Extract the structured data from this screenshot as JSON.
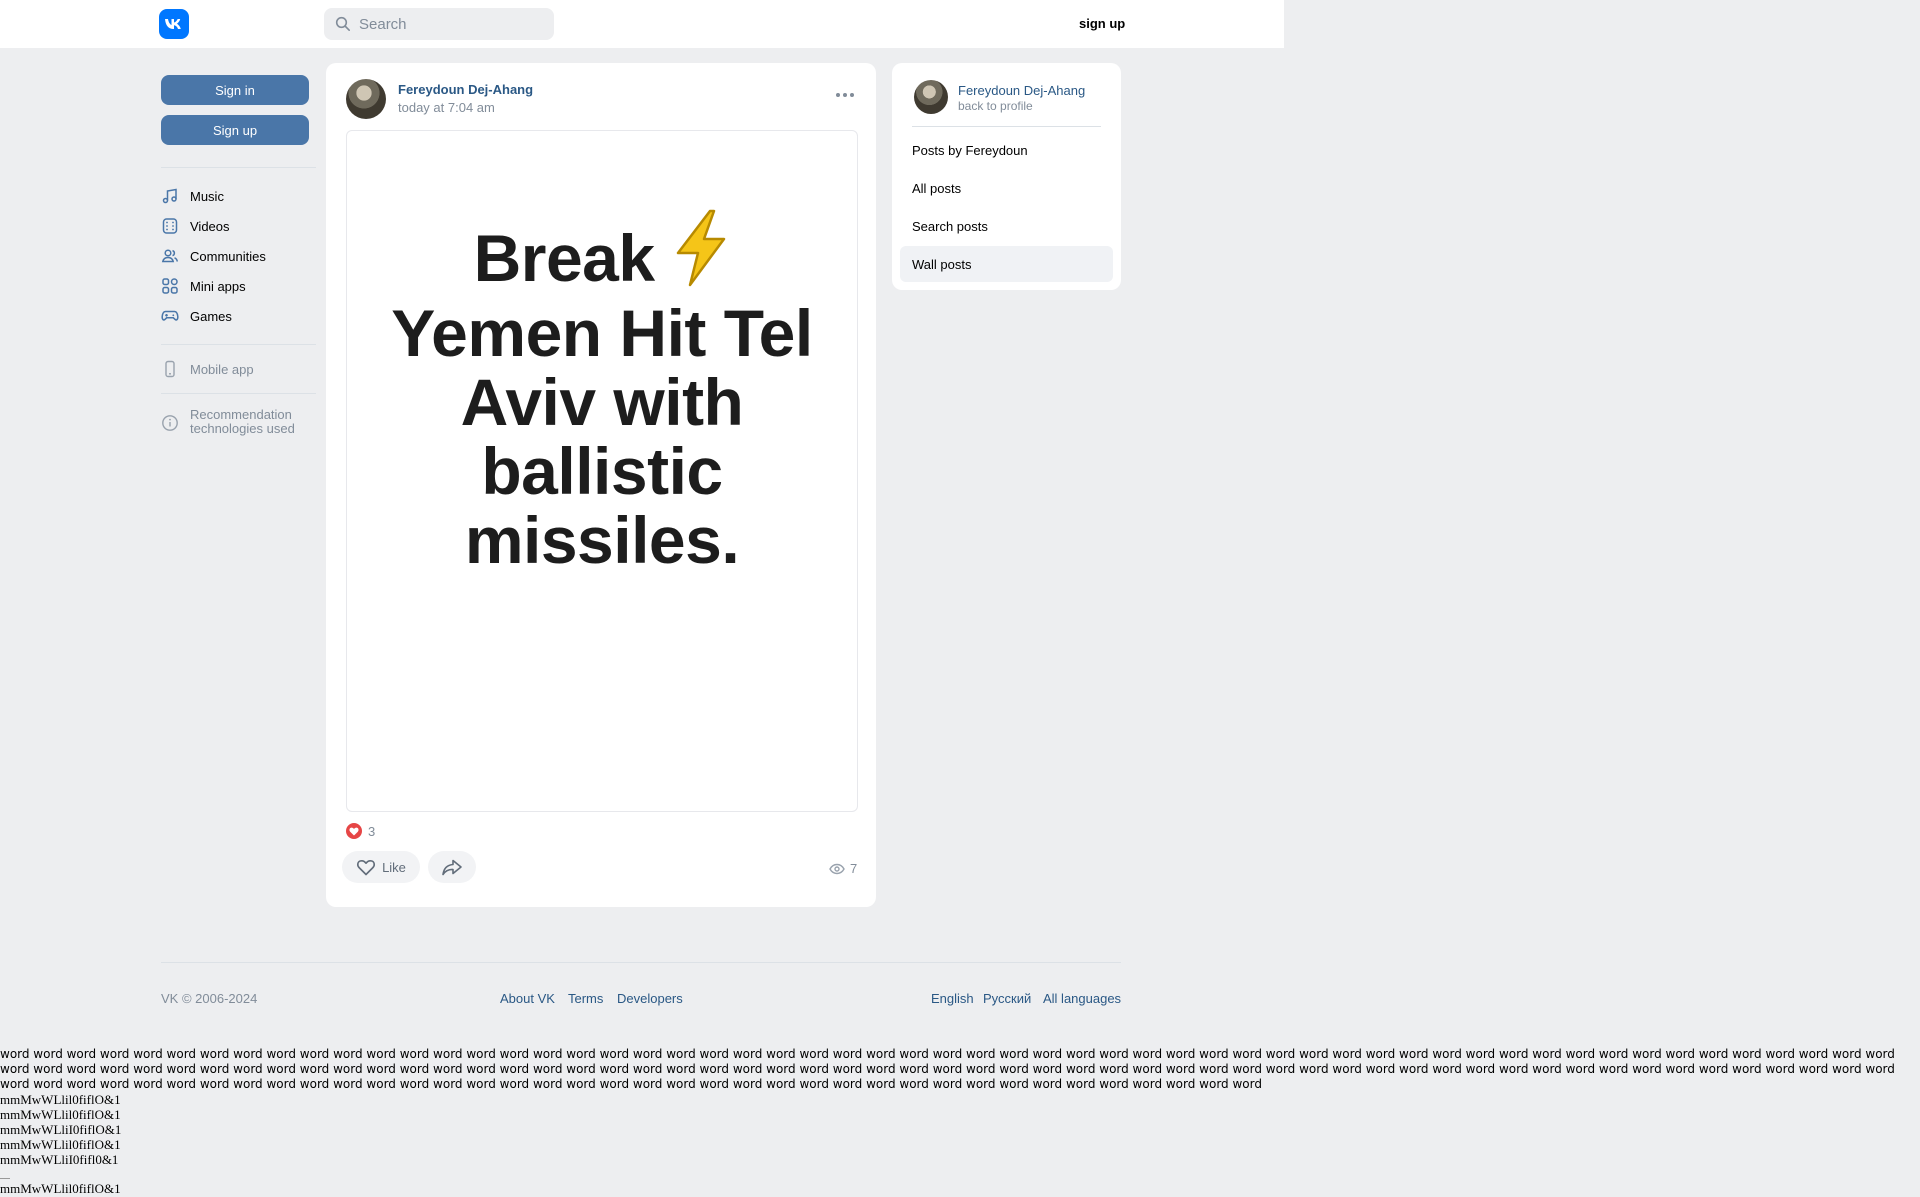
{
  "topbar": {
    "logo_icon": "vk-logo-icon",
    "search_placeholder": "Search",
    "signup_label": "sign up"
  },
  "left": {
    "signin_label": "Sign in",
    "signup_label": "Sign up",
    "nav": [
      {
        "label": "Music",
        "icon": "music-note-icon"
      },
      {
        "label": "Videos",
        "icon": "video-icon"
      },
      {
        "label": "Communities",
        "icon": "users-icon"
      },
      {
        "label": "Mini apps",
        "icon": "grid-icon"
      },
      {
        "label": "Games",
        "icon": "gamepad-icon"
      }
    ],
    "mobile_app": "Mobile app",
    "recommendation_line1": "Recommendation",
    "recommendation_line2": "technologies used"
  },
  "post": {
    "author": "Fereydoun Dej-Ahang",
    "time": "today at 7:04 am",
    "headline_line1": "Break",
    "headline_rest": "Yemen Hit Tel Aviv with ballistic missiles.",
    "reactions_count": "3",
    "like_label": "Like",
    "views_count": "7"
  },
  "side": {
    "name": "Fereydoun Dej-Ahang",
    "back": "back to profile",
    "items": [
      "Posts by Fereydoun",
      "All posts",
      "Search posts",
      "Wall posts"
    ],
    "active_item": "Wall posts"
  },
  "footer": {
    "copyright": "VK © 2006-2024",
    "about": "About VK",
    "terms": "Terms",
    "developers": "Developers",
    "english": "English",
    "russian": "Русский",
    "all_languages": "All languages"
  },
  "filler": {
    "words_line": "word word word word word word word word word word word word word word word word word word word word word word word word word word word word word word word word word word word word word word word word word word word word word word word word word word word word word word word word word word word word word word word word word word word word word word word word word word word word word word word word word word word word word word word word word word word word word word word word word word word word word word word word word word word word word word word word word word word word word word word word word word word word word word word word word word word word word word word word word word word word word word word word word word word word word word word word",
    "mono_lines": [
      "mmMwWLlil0fiflO&1",
      "mmMwWLlil0fiflO&1",
      "mmMwWLliI0fiflO&1",
      "mmMwWLlil0fiflO&1",
      "mmMwWLliI0fifl0&1",
      "mmMwWLlil0fiflO&1"
    ]
  },
  "colors": {
    "accent": "#4a76a8",
    "link": "#2a5885",
    "brand": "#0077ff",
    "background": "#edeef0"
  }
}
